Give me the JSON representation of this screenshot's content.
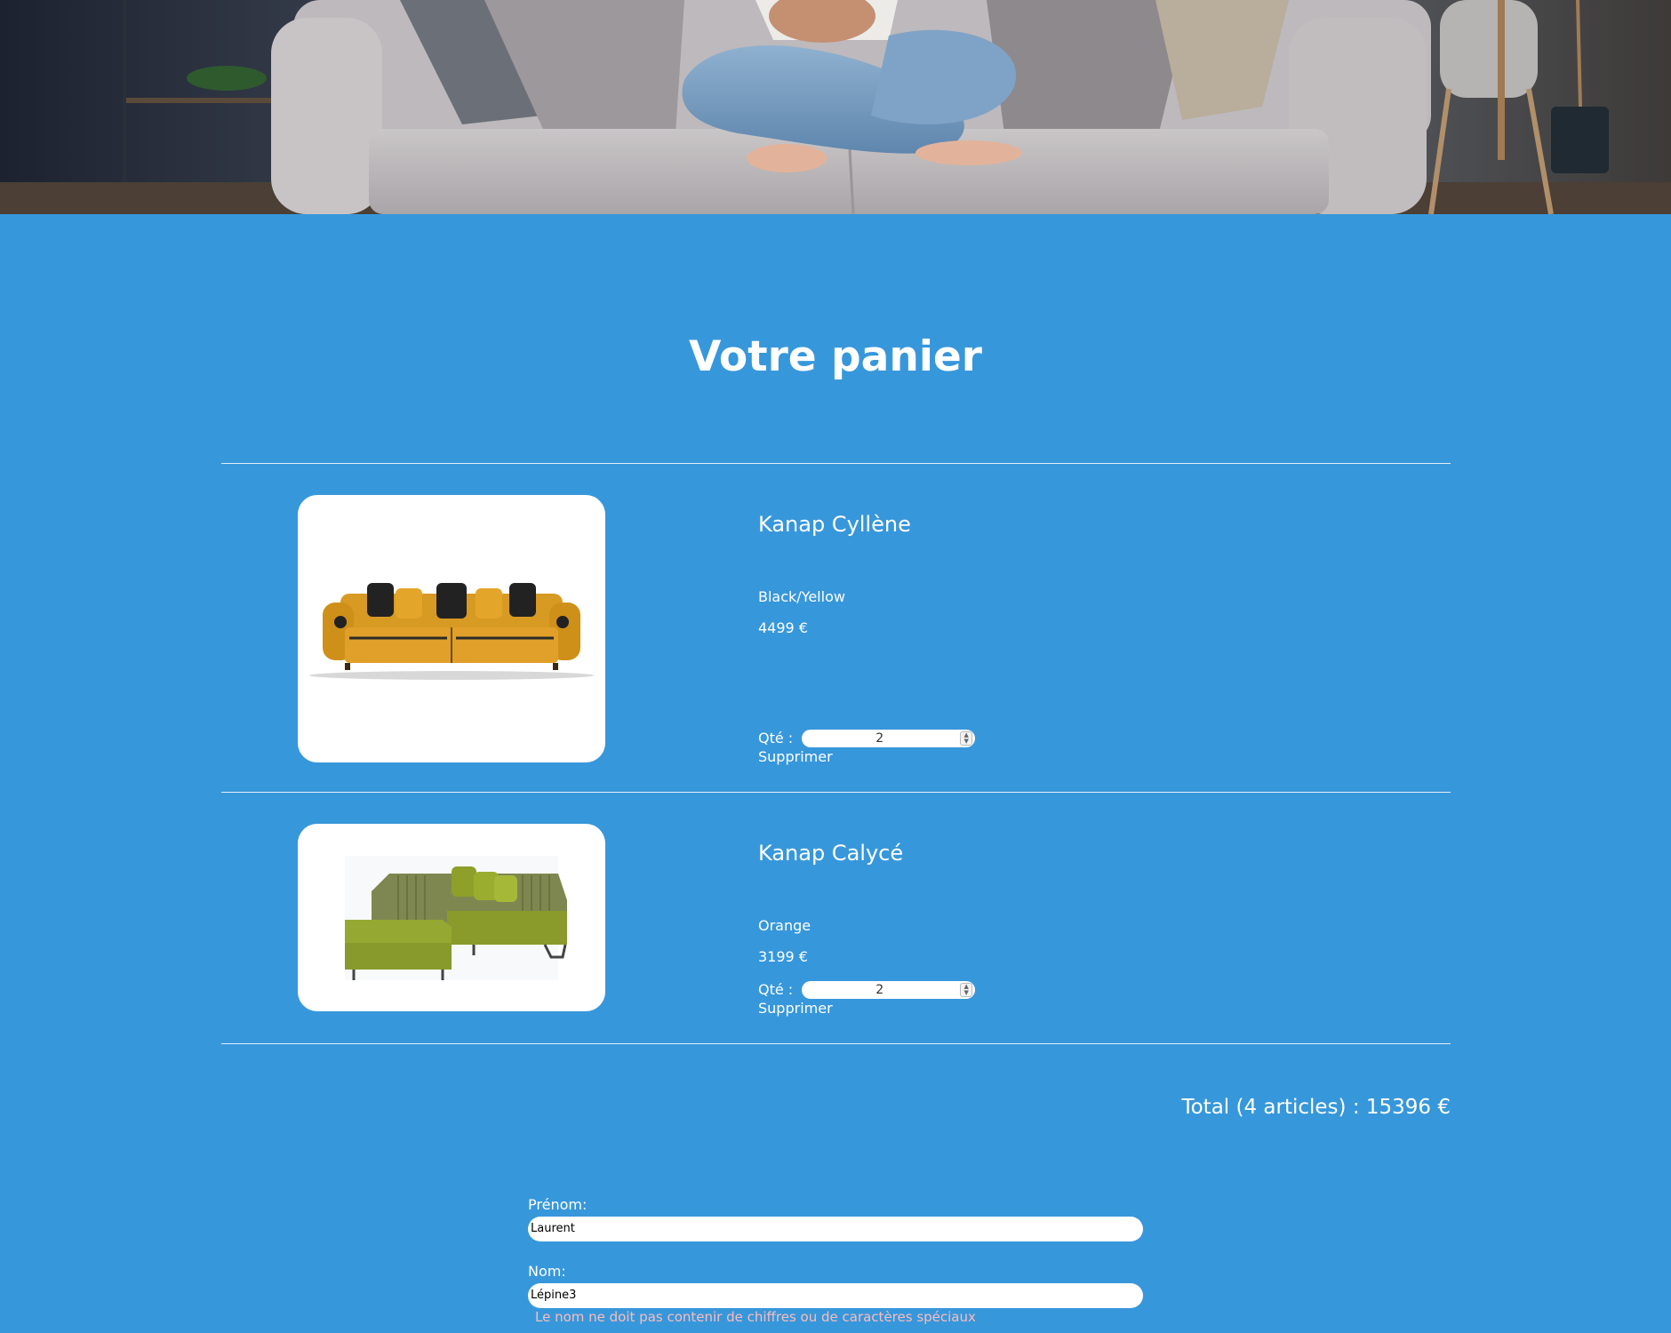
{
  "page": {
    "title": "Votre panier"
  },
  "colors": {
    "background": "#3797DB",
    "text": "#FFFFFF",
    "card": "#FFFFFF",
    "error": "#FBBCBC"
  },
  "cart": {
    "items": [
      {
        "name": "Kanap Cyllène",
        "color": "Black/Yellow",
        "price": "4499 €",
        "qty_label": "Qté :",
        "qty": "2",
        "delete_label": "Supprimer",
        "image_icon": "yellow-sofa-image"
      },
      {
        "name": "Kanap Calycé",
        "color": "Orange",
        "price": "3199 €",
        "qty_label": "Qté :",
        "qty": "2",
        "delete_label": "Supprimer",
        "image_icon": "green-corner-sofa-image"
      }
    ],
    "total": "Total (4 articles) : 15396 €"
  },
  "form": {
    "first_name_label": "Prénom:",
    "first_name_value": "Laurent",
    "last_name_label": "Nom:",
    "last_name_value": "Lépine3",
    "last_name_error": "Le nom ne doit pas contenir de chiffres ou de caractères spéciaux"
  }
}
